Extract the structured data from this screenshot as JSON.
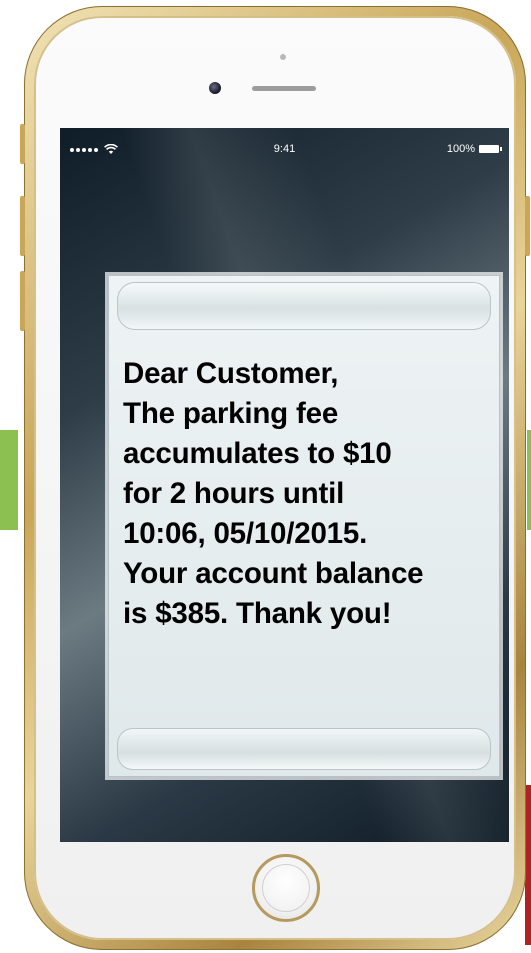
{
  "status_bar": {
    "time": "9:41",
    "battery_percent": "100%",
    "signal_dots": 5,
    "wifi": "wifi-icon"
  },
  "message": {
    "text": "Dear Customer,\nThe parking fee\naccumulates to $10\nfor 2 hours until\n10:06, 05/10/2015.\nYour account balance\nis $385. Thank you!"
  },
  "colors": {
    "phone_gold": "#c9a658",
    "side_green": "#8cc152",
    "side_red": "#b22222"
  }
}
